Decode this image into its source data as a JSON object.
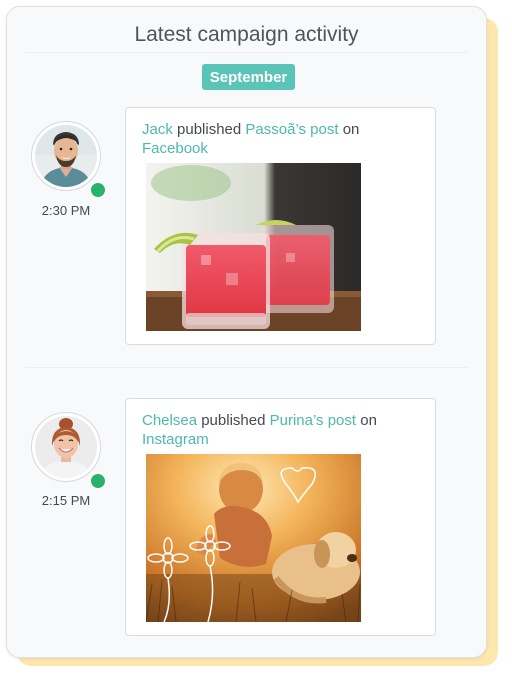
{
  "header": {
    "title": "Latest campaign activity"
  },
  "month_label": "September",
  "activities": [
    {
      "user": "Jack",
      "action": "published",
      "target": "Passoã’s post",
      "preposition": "on",
      "platform": "Facebook",
      "time": "2:30 PM",
      "status": "online"
    },
    {
      "user": "Chelsea",
      "action": "published",
      "target": "Purina’s post",
      "preposition": "on",
      "platform": "Instagram",
      "time": "2:15 PM",
      "status": "online"
    }
  ],
  "colors": {
    "accent": "#5bc4b8",
    "link": "#4fb8ad",
    "online": "#27b36b",
    "back_card": "#fde7ad"
  }
}
